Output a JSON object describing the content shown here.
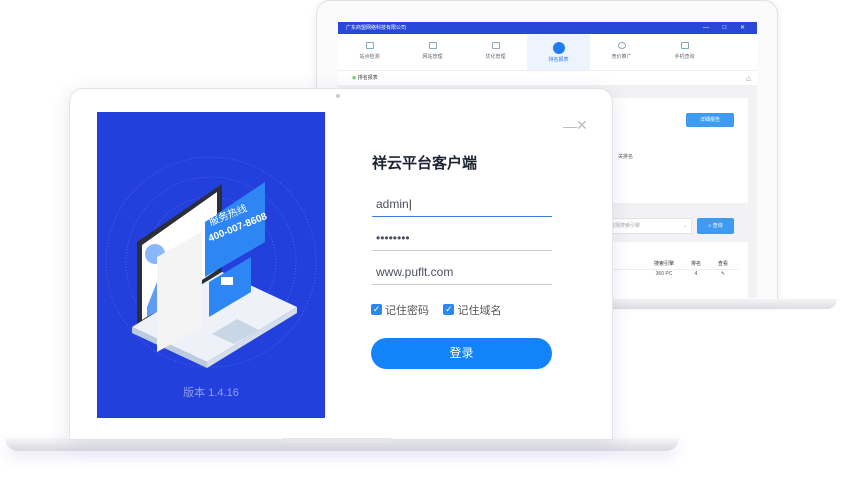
{
  "back_window": {
    "title": "广东商盟网络科技有限公司",
    "window_controls": "— □ ✕",
    "nav": [
      {
        "label": "站点检测"
      },
      {
        "label": "网站管理"
      },
      {
        "label": "优化管理"
      },
      {
        "label": "排名报表",
        "active": true
      },
      {
        "label": "竞价推广"
      },
      {
        "label": "手机查询"
      }
    ],
    "breadcrumb": "排名报表",
    "detail_button": "详细报告",
    "ranking_text": "关排名",
    "engine_placeholder": "请选择搜索引擎",
    "query_button": "查询",
    "table": {
      "headers": [
        "搜索引擎",
        "排名",
        "查看"
      ],
      "rows": [
        [
          "360 PC",
          "4",
          "✎"
        ]
      ]
    }
  },
  "login": {
    "hotline_label": "服务热线",
    "hotline_number": "400-007-8608",
    "version": "版本 1.4.16",
    "title": "祥云平台客户端",
    "username": "admin",
    "password": "••••••••",
    "domain": "www.puflt.com",
    "remember_password": "记住密码",
    "remember_domain": "记住域名",
    "login_button": "登录",
    "minimize": "—",
    "close": "✕"
  },
  "colors": {
    "brand_blue": "#2340dc",
    "accent": "#1283f8"
  }
}
